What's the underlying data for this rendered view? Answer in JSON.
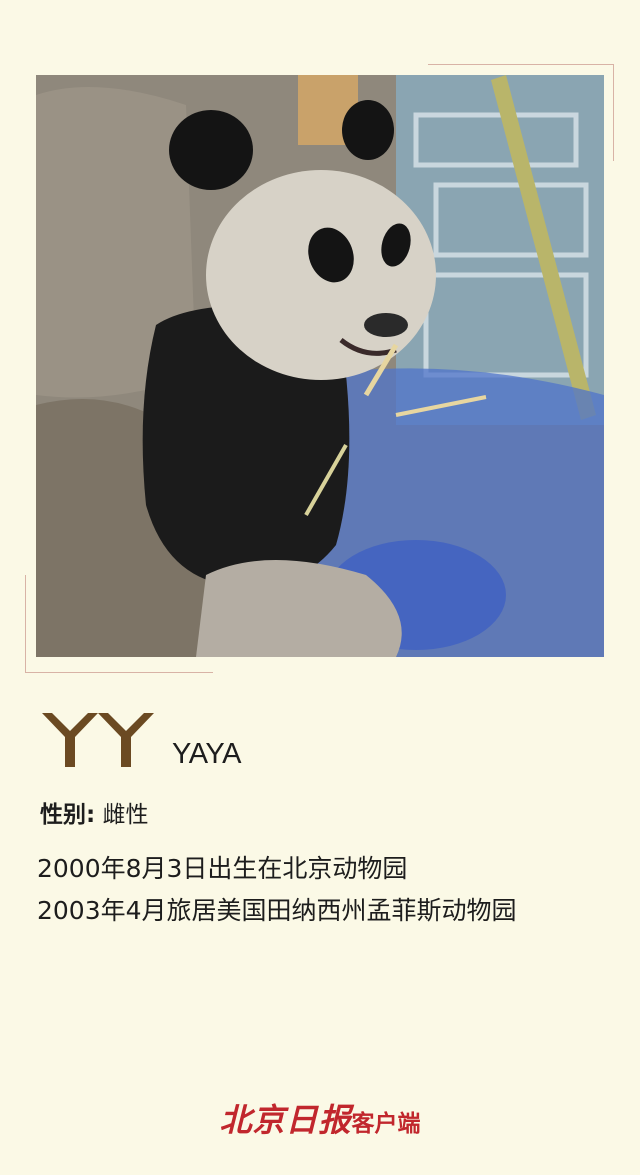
{
  "panda": {
    "logo_icon": "yy-monogram-icon",
    "name_en": "YAYA",
    "gender_label": "性别:",
    "gender_value": "雌性",
    "bio_lines": [
      "2000年8月3日出生在北京动物园",
      "2003年4月旅居美国田纳西州孟菲斯动物园"
    ]
  },
  "footer": {
    "brand_main": "北京日报",
    "brand_sub": "客户端"
  },
  "colors": {
    "background": "#fbf9e6",
    "frame_line": "#d8b3a6",
    "monogram": "#6b4a22",
    "brand_red": "#c1272d"
  }
}
